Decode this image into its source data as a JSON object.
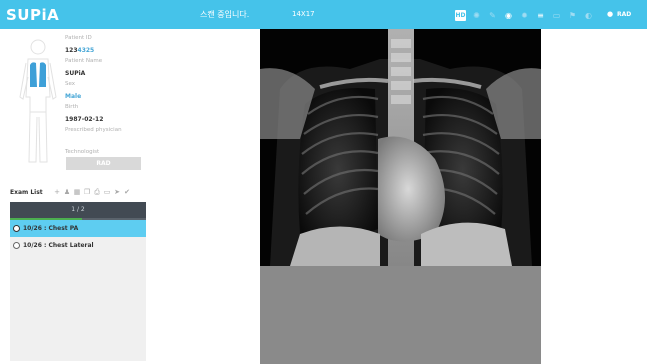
{
  "app": {
    "logo": "SUPiA",
    "status": "스캔 중입니다.",
    "size": "14X17",
    "toolbar": {
      "hd_label": "HD",
      "icons": [
        "hd-icon",
        "exposure-icon",
        "link-icon",
        "record-icon",
        "settings-icon",
        "database-icon",
        "monitor-icon",
        "flag-icon",
        "info-icon",
        "user-icon"
      ],
      "user_label": "RAD"
    }
  },
  "patient": {
    "id_label": "Patient ID",
    "id_value": "1234325",
    "name_label": "Patient Name",
    "name_value": "SUPiA",
    "sex_label": "Sex",
    "sex_value": "Male",
    "birth_label": "Birth",
    "birth_value": "1987-02-12",
    "physician_label": "Prescribed physician",
    "technologist_label": "Technologist",
    "technologist_value": "RAD"
  },
  "exam": {
    "title": "Exam List",
    "pager": "1 / 2",
    "progress": 0.53,
    "items": [
      {
        "label": "10/26 : Chest PA",
        "selected": true
      },
      {
        "label": "10/26 : Chest Lateral",
        "selected": false
      }
    ]
  },
  "colors": {
    "accent": "#45c3ea",
    "selected_row": "#5ecdf1",
    "pager_bg": "#424a53"
  }
}
